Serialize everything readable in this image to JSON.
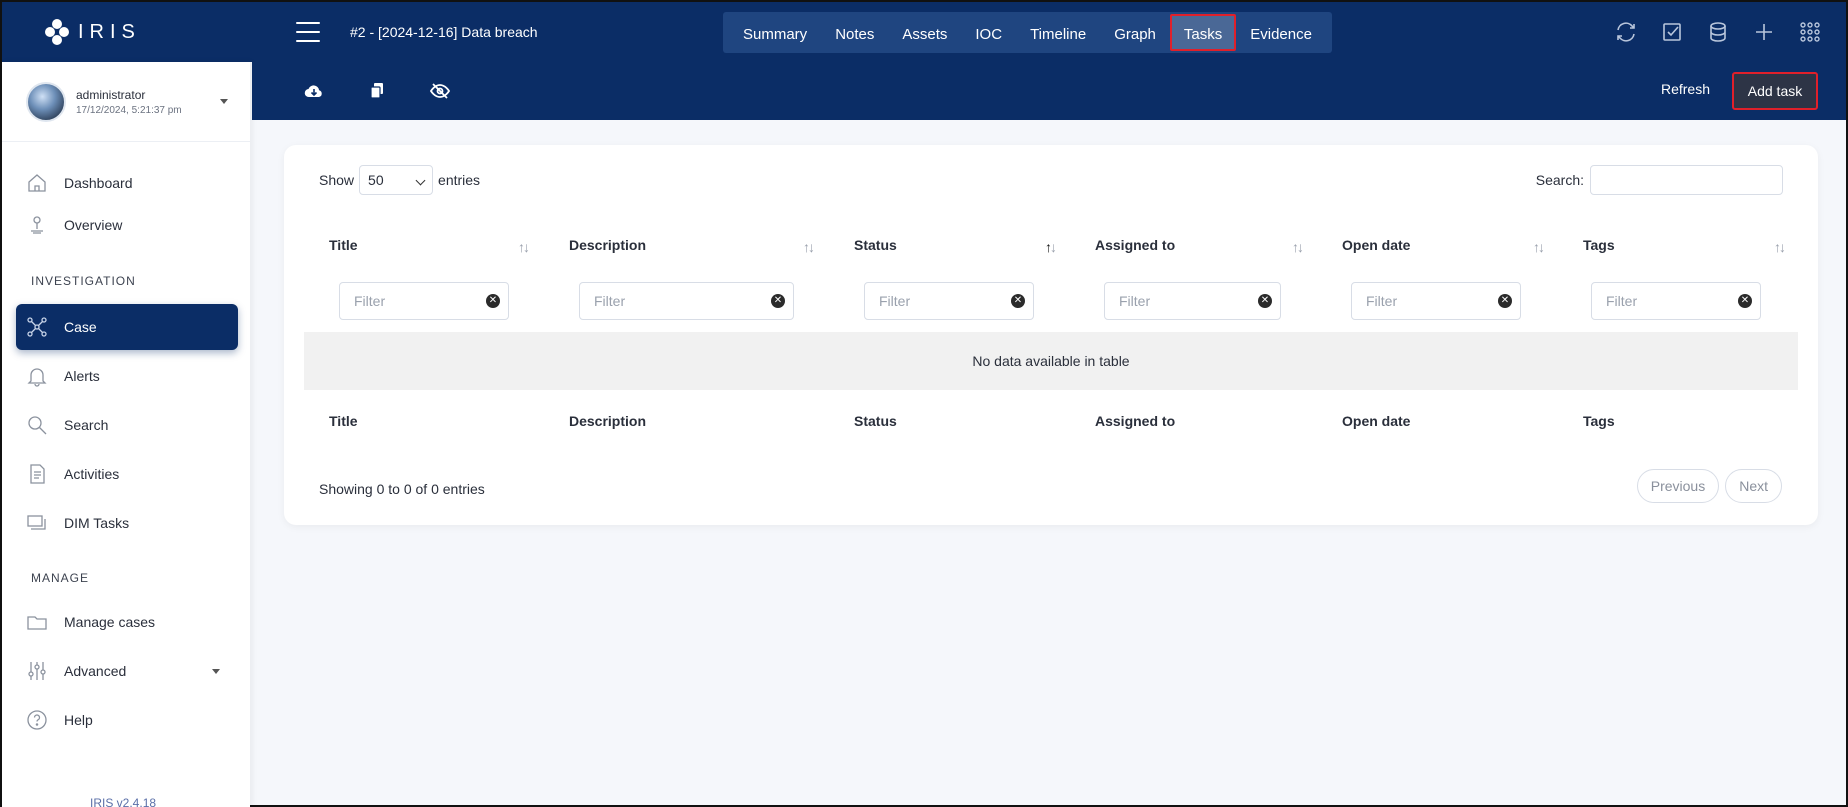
{
  "brand": {
    "name": "IRIS"
  },
  "header": {
    "case_title": "#2 - [2024-12-16] Data breach",
    "tabs": [
      {
        "label": "Summary"
      },
      {
        "label": "Notes"
      },
      {
        "label": "Assets"
      },
      {
        "label": "IOC"
      },
      {
        "label": "Timeline"
      },
      {
        "label": "Graph"
      },
      {
        "label": "Tasks",
        "active": true
      },
      {
        "label": "Evidence"
      }
    ],
    "icons": [
      "sync-icon",
      "check-square-icon",
      "database-icon",
      "plus-icon",
      "apps-grid-icon"
    ]
  },
  "user": {
    "name": "administrator",
    "date": "17/12/2024, 5:21:37 pm"
  },
  "sidebar": {
    "items": [
      {
        "label": "Dashboard",
        "icon": "home-icon"
      },
      {
        "label": "Overview",
        "icon": "person-pin-icon"
      },
      {
        "label": "Case",
        "icon": "network-icon",
        "active": true
      },
      {
        "label": "Alerts",
        "icon": "bell-icon"
      },
      {
        "label": "Search",
        "icon": "search-icon"
      },
      {
        "label": "Activities",
        "icon": "document-icon"
      },
      {
        "label": "DIM Tasks",
        "icon": "stack-icon"
      },
      {
        "label": "Manage cases",
        "icon": "folder-icon"
      },
      {
        "label": "Advanced",
        "icon": "sliders-icon"
      },
      {
        "label": "Help",
        "icon": "help-icon"
      }
    ],
    "sections": {
      "investigation": "INVESTIGATION",
      "manage": "MANAGE"
    },
    "version": "IRIS v2.4.18"
  },
  "toolbar": {
    "icons": [
      "cloud-download-icon",
      "copy-icon",
      "eye-off-icon"
    ],
    "refresh_label": "Refresh",
    "add_task_label": "Add task"
  },
  "table": {
    "show_label": "Show",
    "entries_label": "entries",
    "page_size": "50",
    "search_label": "Search:",
    "columns": [
      "Title",
      "Description",
      "Status",
      "Assigned to",
      "Open date",
      "Tags"
    ],
    "sorted_column": "Status",
    "filter_placeholder": "Filter",
    "empty_message": "No data available in table",
    "info": "Showing 0 to 0 of 0 entries",
    "prev_label": "Previous",
    "next_label": "Next"
  }
}
